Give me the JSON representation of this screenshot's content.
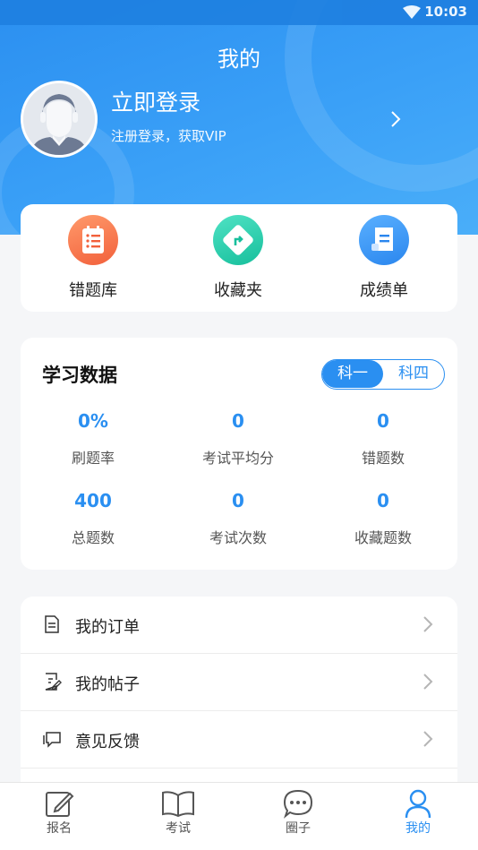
{
  "status": {
    "time": "10:03",
    "wifi_icon": "wifi-icon"
  },
  "header": {
    "title": "我的",
    "login_title": "立即登录",
    "login_subtitle": "注册登录，获取VIP",
    "avatar_icon": "avatar-placeholder-icon",
    "arrow_icon": "chevron-right-icon"
  },
  "shortcuts": [
    {
      "label": "错题库",
      "icon": "wrong-questions-icon",
      "color": "#f2603b"
    },
    {
      "label": "收藏夹",
      "icon": "favorites-icon",
      "color": "#17bf9c"
    },
    {
      "label": "成绩单",
      "icon": "transcript-icon",
      "color": "#2a86ee"
    }
  ],
  "stats": {
    "title": "学习数据",
    "toggle": [
      "科一",
      "科四"
    ],
    "selected": "科一",
    "items": [
      {
        "value": "0%",
        "label": "刷题率"
      },
      {
        "value": "0",
        "label": "考试平均分"
      },
      {
        "value": "0",
        "label": "错题数"
      },
      {
        "value": "400",
        "label": "总题数"
      },
      {
        "value": "0",
        "label": "考试次数"
      },
      {
        "value": "0",
        "label": "收藏题数"
      }
    ]
  },
  "menu": [
    {
      "label": "我的订单",
      "icon": "document-icon"
    },
    {
      "label": "我的帖子",
      "icon": "edit-note-icon"
    },
    {
      "label": "意见反馈",
      "icon": "feedback-icon"
    }
  ],
  "tabs": [
    {
      "label": "报名",
      "icon": "edit-icon"
    },
    {
      "label": "考试",
      "icon": "book-icon"
    },
    {
      "label": "圈子",
      "icon": "chat-icon"
    },
    {
      "label": "我的",
      "icon": "user-icon"
    }
  ],
  "colors": {
    "primary": "#2a8ff1",
    "header": "#3aa0f7"
  },
  "active_tab": "我的"
}
